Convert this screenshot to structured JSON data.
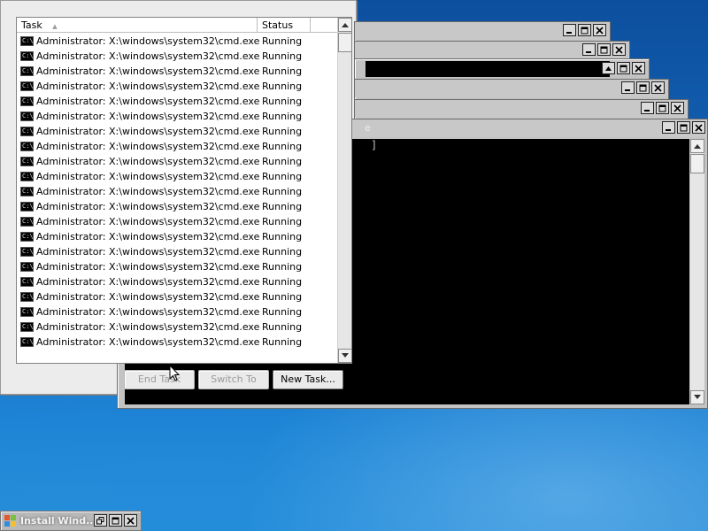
{
  "background_windows": [
    {
      "title": "",
      "buttons": [
        "minimize-icon",
        "maximize-icon",
        "close-icon"
      ]
    },
    {
      "title": "",
      "buttons": [
        "minimize-icon",
        "maximize-icon",
        "close-icon"
      ]
    },
    {
      "title": "",
      "buttons": [
        "minimize-icon",
        "maximize-icon",
        "close-icon"
      ]
    },
    {
      "title": "",
      "buttons": [
        "minimize-icon",
        "maximize-icon",
        "close-icon"
      ]
    },
    {
      "title": "",
      "buttons": [
        "minimize-icon",
        "maximize-icon",
        "close-icon"
      ]
    },
    {
      "title": "e",
      "buttons": [
        "minimize-icon",
        "maximize-icon",
        "close-icon"
      ],
      "console_text": "]"
    }
  ],
  "taskmgr": {
    "columns": {
      "task": "Task",
      "status": "Status"
    },
    "sort_indicator": "▲",
    "rows": [
      {
        "task": "Administrator: X:\\windows\\system32\\cmd.exe",
        "status": "Running"
      },
      {
        "task": "Administrator: X:\\windows\\system32\\cmd.exe",
        "status": "Running"
      },
      {
        "task": "Administrator: X:\\windows\\system32\\cmd.exe",
        "status": "Running"
      },
      {
        "task": "Administrator: X:\\windows\\system32\\cmd.exe",
        "status": "Running"
      },
      {
        "task": "Administrator: X:\\windows\\system32\\cmd.exe",
        "status": "Running"
      },
      {
        "task": "Administrator: X:\\windows\\system32\\cmd.exe",
        "status": "Running"
      },
      {
        "task": "Administrator: X:\\windows\\system32\\cmd.exe",
        "status": "Running"
      },
      {
        "task": "Administrator: X:\\windows\\system32\\cmd.exe",
        "status": "Running"
      },
      {
        "task": "Administrator: X:\\windows\\system32\\cmd.exe",
        "status": "Running"
      },
      {
        "task": "Administrator: X:\\windows\\system32\\cmd.exe",
        "status": "Running"
      },
      {
        "task": "Administrator: X:\\windows\\system32\\cmd.exe",
        "status": "Running"
      },
      {
        "task": "Administrator: X:\\windows\\system32\\cmd.exe",
        "status": "Running"
      },
      {
        "task": "Administrator: X:\\windows\\system32\\cmd.exe",
        "status": "Running"
      },
      {
        "task": "Administrator: X:\\windows\\system32\\cmd.exe",
        "status": "Running"
      },
      {
        "task": "Administrator: X:\\windows\\system32\\cmd.exe",
        "status": "Running"
      },
      {
        "task": "Administrator: X:\\windows\\system32\\cmd.exe",
        "status": "Running"
      },
      {
        "task": "Administrator: X:\\windows\\system32\\cmd.exe",
        "status": "Running"
      },
      {
        "task": "Administrator: X:\\windows\\system32\\cmd.exe",
        "status": "Running"
      },
      {
        "task": "Administrator: X:\\windows\\system32\\cmd.exe",
        "status": "Running"
      },
      {
        "task": "Administrator: X:\\windows\\system32\\cmd.exe",
        "status": "Running"
      },
      {
        "task": "Administrator: X:\\windows\\system32\\cmd.exe",
        "status": "Running"
      }
    ],
    "buttons": {
      "end_task": "End Task",
      "switch_to": "Switch To",
      "new_task": "New Task..."
    }
  },
  "taskbar_window": {
    "title": "Install Wind..."
  },
  "icons": {
    "cmd_icon_text": "C:\\"
  }
}
